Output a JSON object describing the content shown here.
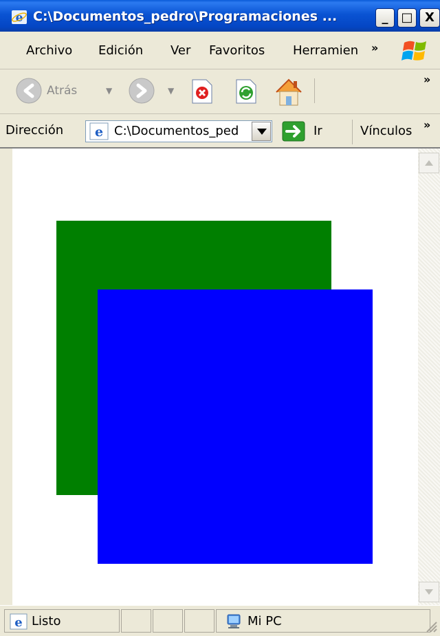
{
  "window": {
    "title": "C:\\Documentos_pedro\\Programaciones ...",
    "minimize": "_",
    "maximize": "□",
    "close": "X"
  },
  "menu": {
    "items": [
      "Archivo",
      "Edición",
      "Ver",
      "Favoritos",
      "Herramien"
    ],
    "overflow": "»"
  },
  "toolbar": {
    "back_label": "Atrás",
    "overflow": "»"
  },
  "address": {
    "label": "Dirección",
    "value": "C:\\Documentos_ped",
    "go_label": "Ir",
    "links_label": "Vínculos",
    "links_overflow": "»"
  },
  "content": {
    "shapes": [
      {
        "name": "green-square",
        "color": "#007f00"
      },
      {
        "name": "blue-square",
        "color": "#0000ff"
      }
    ]
  },
  "status": {
    "text": "Listo",
    "zone": "Mi PC"
  }
}
